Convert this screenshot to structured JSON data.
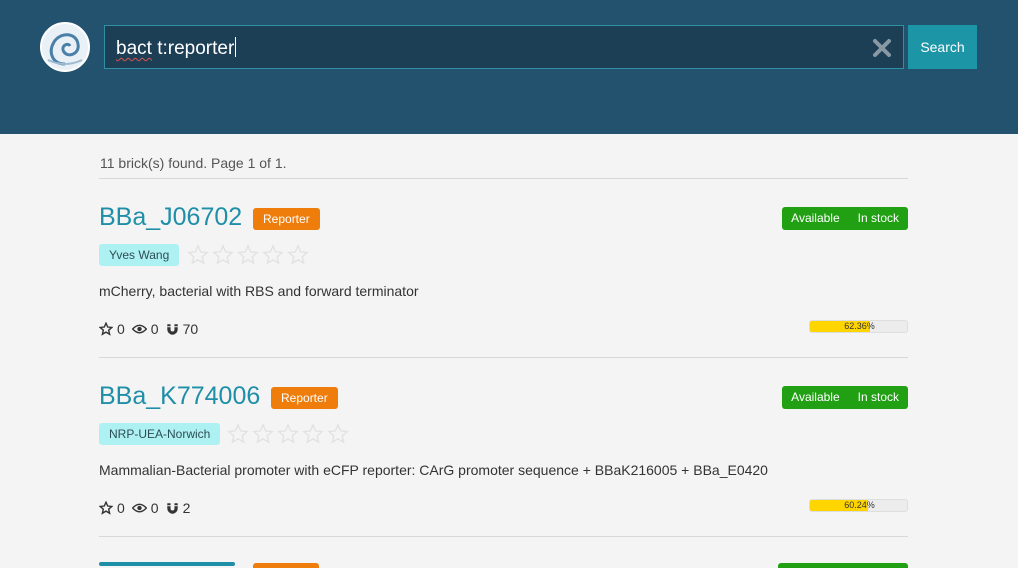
{
  "search": {
    "query_misspelled": "bact",
    "query_rest": " t:reporter",
    "button_label": "Search"
  },
  "results": {
    "count_text": "11 brick(s) found. Page 1 of 1."
  },
  "cards": [
    {
      "name": "BBa_J06702",
      "type": "Reporter",
      "status_availability": "Available",
      "status_stock": "In stock",
      "author": "Yves Wang",
      "rating_stars": 0,
      "description": "mCherry, bacterial with RBS and forward terminator",
      "favorites": "0",
      "views": "0",
      "uses": "70",
      "progress_value": 0.6236,
      "progress_label": "62.36%"
    },
    {
      "name": "BBa_K774006",
      "type": "Reporter",
      "status_availability": "Available",
      "status_stock": "In stock",
      "author": "NRP-UEA-Norwich",
      "rating_stars": 0,
      "description": "Mammalian-Bacterial promoter with eCFP reporter: CArG promoter sequence + BBaK216005 + BBa_E0420",
      "favorites": "0",
      "views": "0",
      "uses": "2",
      "progress_value": 0.6024,
      "progress_label": "60.24%"
    }
  ],
  "colors": {
    "header": "#23526f",
    "accent": "#1c95a7",
    "link": "#1f8fa8",
    "type_badge": "#ee7d0c",
    "status": "#20a012",
    "author_badge": "#aef1f3",
    "progress": "#ffd500"
  }
}
